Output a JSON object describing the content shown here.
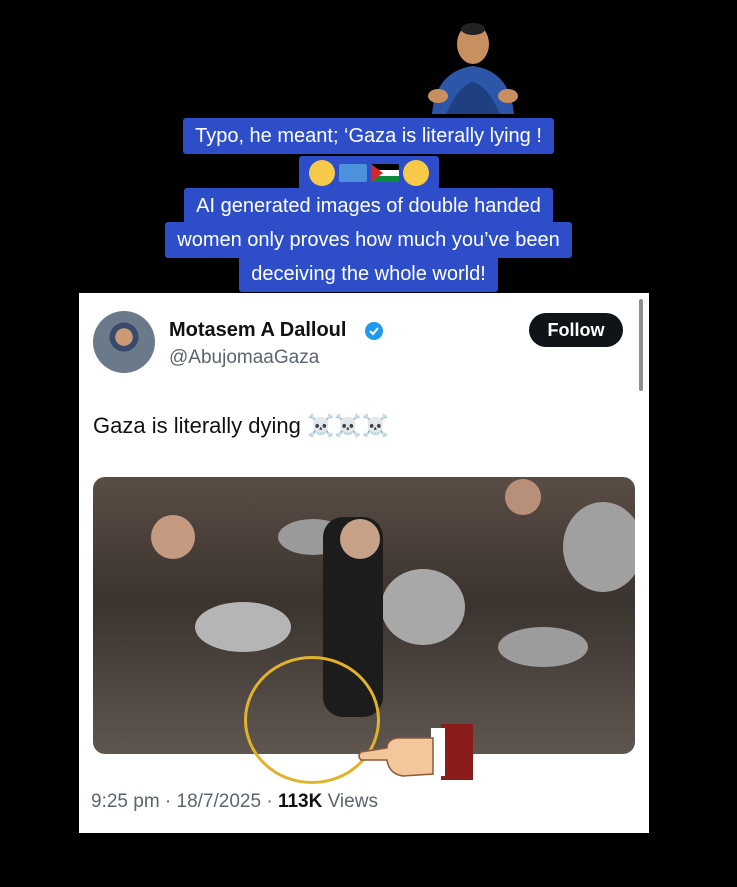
{
  "caption": {
    "line1": "Typo, he meant; ‘Gaza is literally lying !",
    "line2": "AI generated images of double handed",
    "line3": "women only proves how much you’ve been",
    "line4": "deceiving the whole world!"
  },
  "tweet": {
    "name": "Motasem A Dalloul",
    "handle": "@AbujomaaGaza",
    "follow_label": "Follow",
    "text": "Gaza is literally dying ☠️☠️☠️",
    "time_date": "9:25 pm · 18/7/2025 · ",
    "views_count": "113K",
    "views_label": " Views"
  },
  "colors": {
    "caption_bg": "#2d4ec8",
    "circle": "#e1b22c",
    "verified": "#1d9bf0"
  },
  "icons": [
    "thinking-face-icon",
    "un-flag-icon",
    "palestine-flag-icon",
    "verified-badge-icon",
    "pointing-hand-icon"
  ]
}
